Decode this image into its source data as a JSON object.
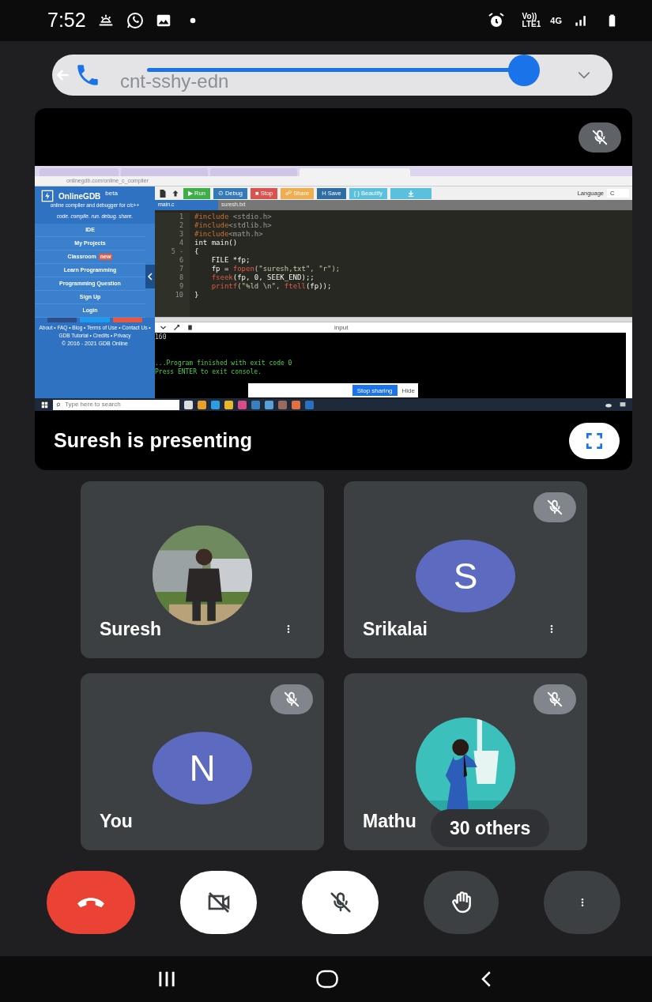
{
  "status_bar": {
    "time": "7:52",
    "volte": "Vo))",
    "lte": "LTE1",
    "network": "4G"
  },
  "call_bar": {
    "meeting_code": "cnt-sshy-edn",
    "level": 1
  },
  "presentation": {
    "muted": true,
    "caption": "Suresh is presenting",
    "shared_screen": {
      "url": "onlinegdb.com/online_c_compiler",
      "brand": "OnlineGDB",
      "brand_badge": "beta",
      "tagline": "online compiler and debugger for c/c++",
      "motto": "code. compile. run. debug. share.",
      "menu": [
        {
          "label": "IDE"
        },
        {
          "label": "My Projects"
        },
        {
          "label": "Classroom",
          "badge": "new"
        },
        {
          "label": "Learn Programming"
        },
        {
          "label": "Programming Question"
        },
        {
          "label": "Sign Up"
        },
        {
          "label": "Login"
        }
      ],
      "footer": "About • FAQ • Blog • Terms of Use • Contact Us • GDB Tutorial • Credits • Privacy",
      "copyright": "© 2016 - 2021 GDB Online",
      "toolbar": [
        {
          "label": "▶ Run",
          "color": "#3fae49"
        },
        {
          "label": "⊙ Debug",
          "color": "#337ab7"
        },
        {
          "label": "■ Stop",
          "color": "#d9534f"
        },
        {
          "label": "☍ Share",
          "color": "#f0ad4e"
        },
        {
          "label": "H Save",
          "color": "#2e6da4"
        },
        {
          "label": "{ } Beautify",
          "color": "#5bc0de"
        }
      ],
      "language_label": "Language",
      "language": "C",
      "file_tabs": [
        {
          "label": "main.c",
          "selected": true
        },
        {
          "label": "suresh.txt",
          "selected": false
        }
      ],
      "code": [
        {
          "number": "1",
          "tokens": [
            {
              "text": "#include",
              "kind": "directive"
            },
            {
              "text": " <stdio.h>",
              "kind": "header"
            }
          ]
        },
        {
          "number": "2",
          "tokens": [
            {
              "text": "#include",
              "kind": "directive"
            },
            {
              "text": "<stdlib.h>",
              "kind": "header"
            }
          ]
        },
        {
          "number": "3",
          "tokens": [
            {
              "text": "#include",
              "kind": "directive"
            },
            {
              "text": "<math.h>",
              "kind": "header"
            }
          ]
        },
        {
          "number": "4",
          "tokens": [
            {
              "text": "int main()",
              "kind": "plain"
            }
          ]
        },
        {
          "number": "5 -",
          "tokens": [
            {
              "text": "{",
              "kind": "plain"
            }
          ]
        },
        {
          "number": "6",
          "indented": true,
          "tokens": [
            {
              "text": "FILE *fp;",
              "kind": "plain"
            }
          ]
        },
        {
          "number": "7",
          "indented": true,
          "tokens": [
            {
              "text": "fp = ",
              "kind": "plain"
            },
            {
              "text": "fopen",
              "kind": "function"
            },
            {
              "text": "(\"suresh,txt\", \"r\");",
              "kind": "string"
            }
          ]
        },
        {
          "number": "8",
          "indented": true,
          "tokens": [
            {
              "text": "fseek",
              "kind": "function"
            },
            {
              "text": "(fp, 0, SEEK_END);;",
              "kind": "plain"
            }
          ]
        },
        {
          "number": "9",
          "indented": true,
          "tokens": [
            {
              "text": "printf",
              "kind": "function"
            },
            {
              "text": "(\"%ld \\n\", ",
              "kind": "string"
            },
            {
              "text": "ftell",
              "kind": "function"
            },
            {
              "text": "(fp));",
              "kind": "plain"
            }
          ]
        },
        {
          "number": "10",
          "tokens": [
            {
              "text": "}",
              "kind": "plain"
            }
          ]
        }
      ],
      "console_label": "input",
      "console": [
        {
          "text": "160",
          "kind": "output"
        },
        {
          "text": "...Program finished with exit code 0",
          "kind": "status"
        },
        {
          "text": "Press ENTER to exit console.",
          "kind": "status"
        }
      ],
      "stop_sharing": "Stop sharing",
      "hide": "Hide",
      "search_placeholder": "Type here to search"
    }
  },
  "participants": [
    {
      "name": "Suresh",
      "muted": false,
      "menu": true
    },
    {
      "name": "Srikalai",
      "kind": "initial",
      "initial": "S",
      "muted": true,
      "menu": true
    },
    {
      "name": "You",
      "kind": "initial",
      "initial": "N",
      "muted": true,
      "menu": false
    },
    {
      "name": "Mathu",
      "muted": true,
      "menu": false,
      "others": "30 others"
    }
  ],
  "controls": [
    {
      "kind": "end-call"
    },
    {
      "kind": "camera",
      "on": false
    },
    {
      "kind": "mic",
      "on": false
    },
    {
      "kind": "hand"
    },
    {
      "kind": "more"
    }
  ],
  "nav_bar": [
    {
      "kind": "recents"
    },
    {
      "kind": "home"
    },
    {
      "kind": "back"
    }
  ]
}
